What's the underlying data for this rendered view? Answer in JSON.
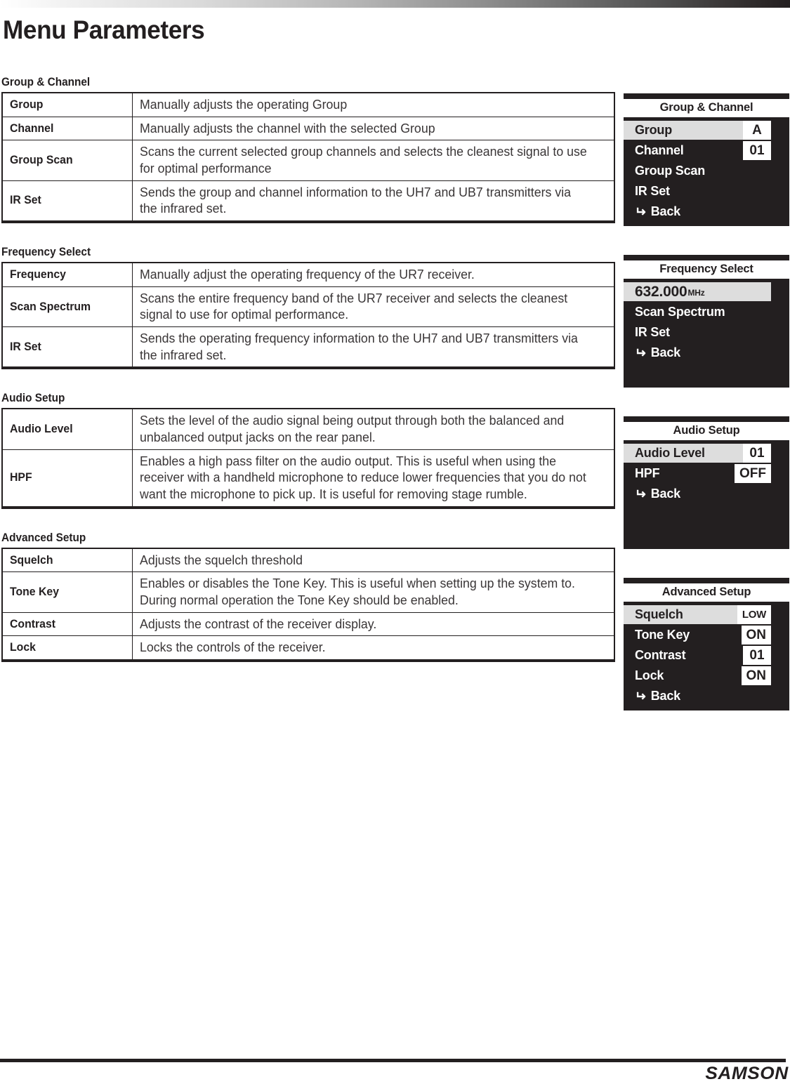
{
  "page": {
    "title": "Menu Parameters",
    "footer_logo": "SAMSON"
  },
  "sections": [
    {
      "heading": "Group & Channel",
      "rows": [
        {
          "name": "Group",
          "description": "Manually adjusts the operating Group"
        },
        {
          "name": "Channel",
          "description": "Manually adjusts the channel with the selected Group"
        },
        {
          "name": "Group Scan",
          "description": "Scans the current selected group channels and selects the cleanest signal to use for optimal performance"
        },
        {
          "name": "IR Set",
          "description": "Sends the group and channel information to the UH7 and UB7 transmitters via the infrared set."
        }
      ]
    },
    {
      "heading": "Frequency Select",
      "rows": [
        {
          "name": "Frequency",
          "description": "Manually adjust the operating frequency of the UR7 receiver."
        },
        {
          "name": "Scan Spectrum",
          "description": "Scans the entire frequency band of the UR7 receiver and selects the cleanest signal to use for optimal performance."
        },
        {
          "name": "IR Set",
          "description": "Sends the operating frequency information to the UH7 and UB7 transmitters via the infrared set."
        }
      ]
    },
    {
      "heading": "Audio Setup",
      "rows": [
        {
          "name": "Audio Level",
          "description": "Sets the level of the audio signal being output through both the balanced and unbalanced output jacks on the rear panel."
        },
        {
          "name": "HPF",
          "description": "Enables a high pass filter on the audio output. This is useful when using the receiver with a handheld microphone to reduce lower frequencies that you do not want the microphone to pick up. It is useful for removing stage rumble."
        }
      ]
    },
    {
      "heading": "Advanced Setup",
      "rows": [
        {
          "name": "Squelch",
          "description": "Adjusts the squelch threshold"
        },
        {
          "name": "Tone Key",
          "description": "Enables or disables the Tone Key. This is useful when setting up the system to. During normal operation the Tone Key should be enabled."
        },
        {
          "name": "Contrast",
          "description": "Adjusts the contrast of the receiver display."
        },
        {
          "name": "Lock",
          "description": "Locks the controls of the receiver."
        }
      ]
    }
  ],
  "lcd_panels": [
    {
      "title": "Group & Channel",
      "items": [
        {
          "label": "Group",
          "value": "A",
          "highlighted": true
        },
        {
          "label": "Channel",
          "value": "01",
          "highlighted": false
        },
        {
          "label": "Group Scan",
          "value": "",
          "highlighted": false
        },
        {
          "label": "IR Set",
          "value": "",
          "highlighted": false
        },
        {
          "label": "Back",
          "value": "",
          "highlighted": false,
          "icon": "enter-return-arrow-icon"
        }
      ]
    },
    {
      "title": "Frequency Select",
      "items": [
        {
          "label": "632.000",
          "unit": "MHz",
          "frequency": true,
          "highlighted": true
        },
        {
          "label": "Scan Spectrum",
          "value": "",
          "highlighted": false
        },
        {
          "label": "IR Set",
          "value": "",
          "highlighted": false
        },
        {
          "label": "Back",
          "value": "",
          "highlighted": false,
          "icon": "enter-return-arrow-icon"
        }
      ]
    },
    {
      "title": "Audio Setup",
      "items": [
        {
          "label": "Audio Level",
          "value": "01",
          "highlighted": true
        },
        {
          "label": "HPF",
          "value": "OFF",
          "highlighted": false
        },
        {
          "label": "Back",
          "value": "",
          "highlighted": false,
          "icon": "enter-return-arrow-icon"
        }
      ]
    },
    {
      "title": "Advanced Setup",
      "items": [
        {
          "label": "Squelch",
          "value": "LOW",
          "narrow": true,
          "highlighted": true
        },
        {
          "label": "Tone Key",
          "value": "ON",
          "highlighted": false
        },
        {
          "label": "Contrast",
          "value": "01",
          "highlighted": false
        },
        {
          "label": "Lock",
          "value": "ON",
          "highlighted": false
        },
        {
          "label": "Back",
          "value": "",
          "highlighted": false,
          "icon": "enter-return-arrow-icon"
        }
      ]
    }
  ],
  "colors": {
    "ink": "#231f20",
    "lcd_background": "#231f20",
    "lcd_highlight": "#dddddd",
    "lcd_value_background": "#ffffff"
  }
}
